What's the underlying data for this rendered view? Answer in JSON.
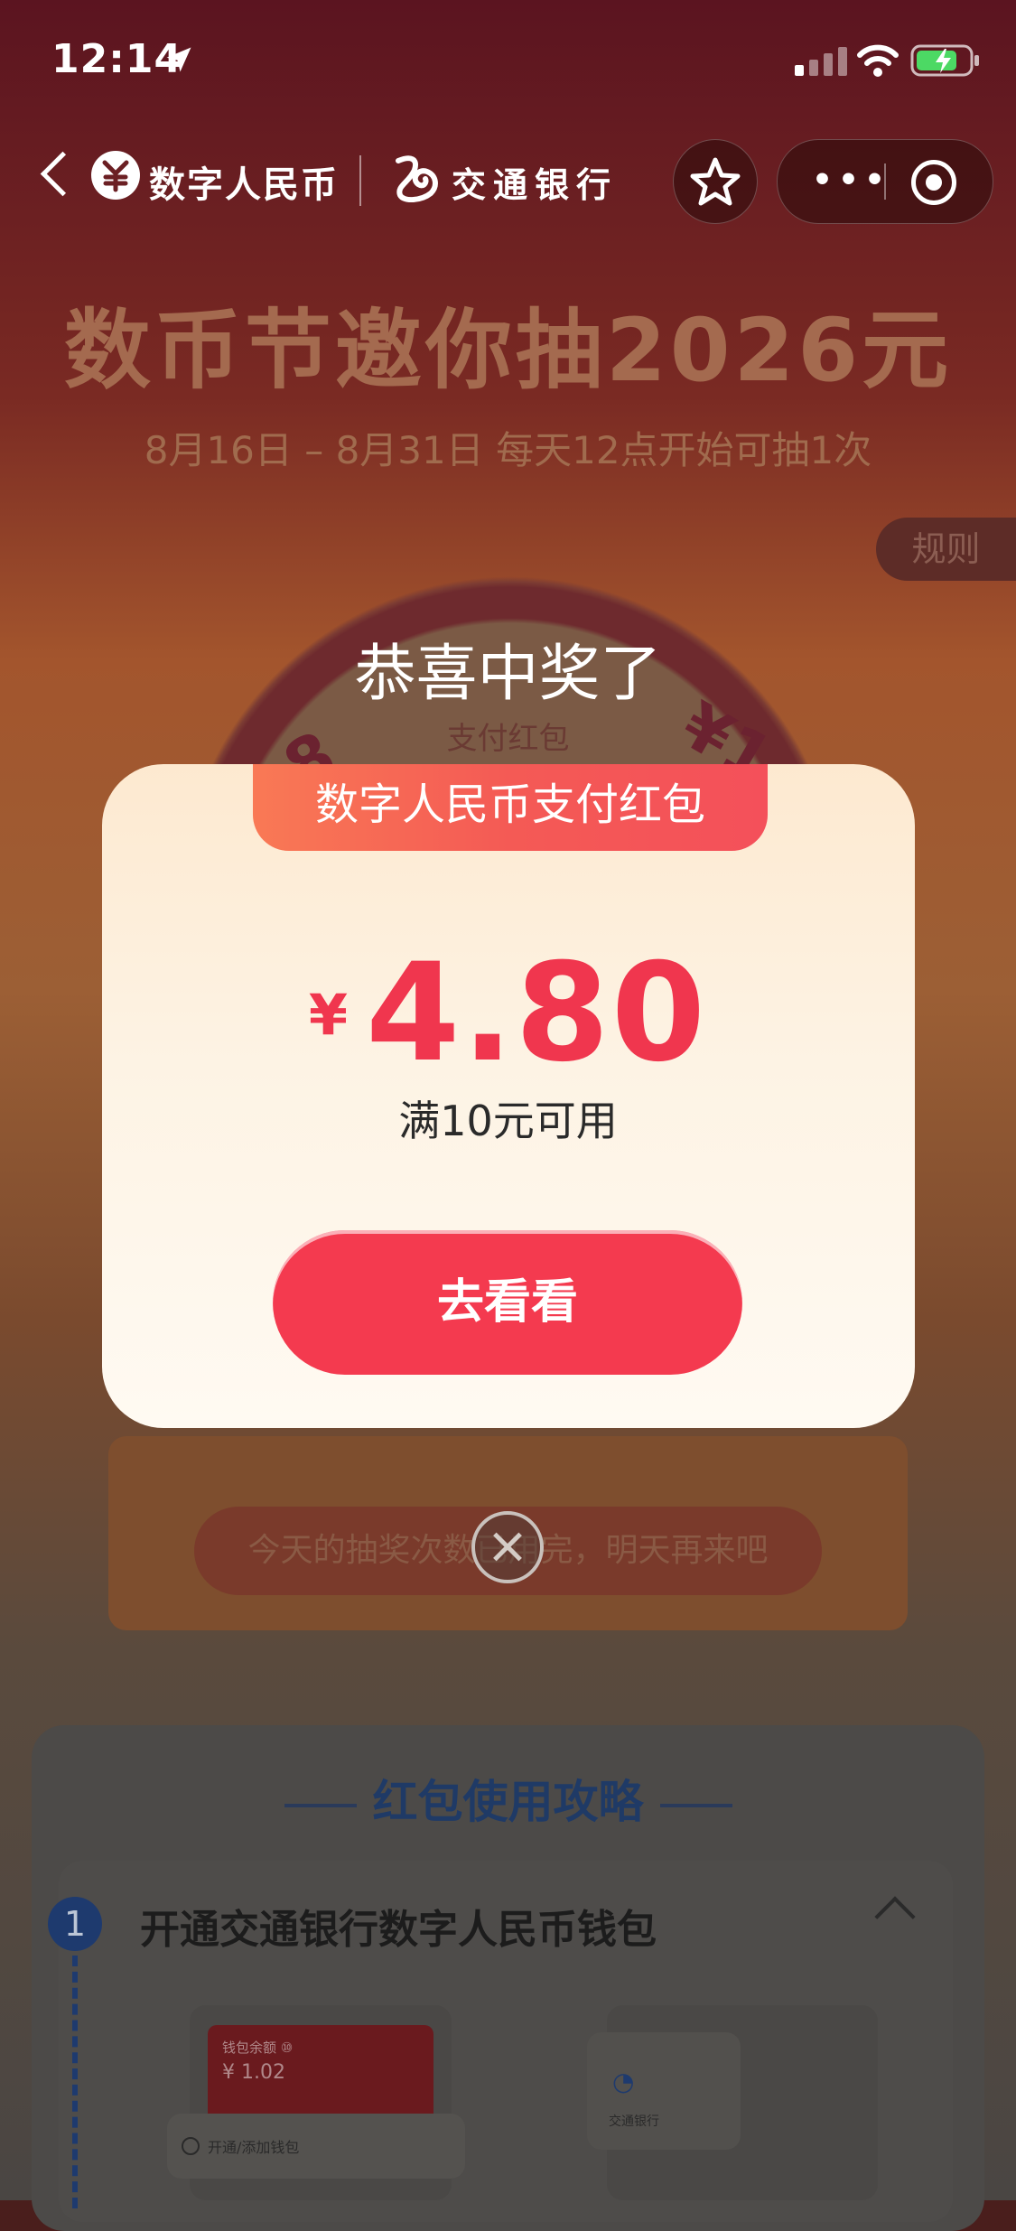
{
  "status_bar": {
    "time": "12:14",
    "icons": [
      "location-arrow-icon",
      "cellular-signal-icon",
      "wifi-icon",
      "battery-charging-icon"
    ]
  },
  "nav": {
    "app_name": "数字人民币",
    "bank_name": "交通银行"
  },
  "background": {
    "title": "数币节邀你抽2026元",
    "subtitle": "8月16日 – 8月31日  每天12点开始可抽1次",
    "rules_label": "规则",
    "wheel_label": "支付红包",
    "wheel_prize_left": "8",
    "wheel_prize_right": "¥1",
    "chances_text": "今天的抽奖次数已用完，明天再来吧",
    "guide_title": "红包使用攻略",
    "step_number": "1",
    "step_text": "开通交通银行数字人民币钱包",
    "thumb_left_balance_label": "钱包余额 ⑩",
    "thumb_left_balance": "¥ 1.02",
    "thumb_left_action": "开通/添加钱包",
    "thumb_right_bank": "交通银行"
  },
  "modal": {
    "heading": "恭喜中奖了",
    "ribbon_label": "数字人民币支付红包",
    "currency": "¥",
    "amount": "4.80",
    "condition": "满10元可用",
    "button_label": "去看看"
  },
  "colors": {
    "accent_red": "#f0364e",
    "button_red": "#f43a4f",
    "ribbon_start": "#f97955",
    "ribbon_end": "#f4505a"
  }
}
